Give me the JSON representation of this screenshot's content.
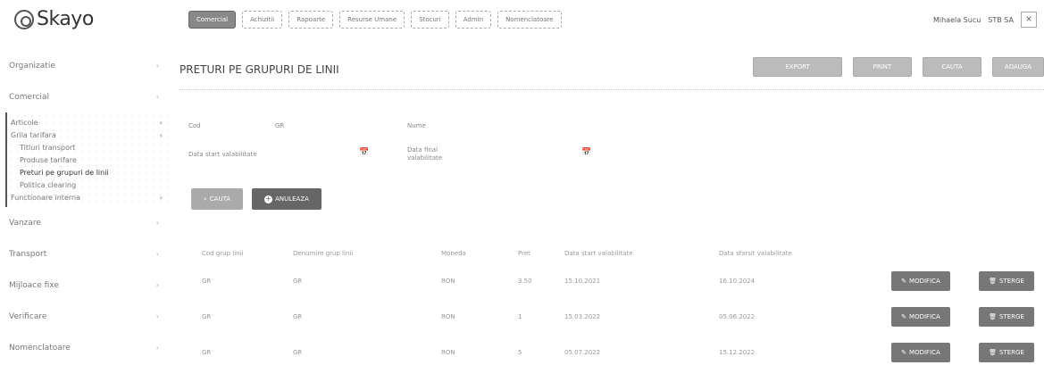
{
  "app": {
    "name": "Skayo"
  },
  "topnav": {
    "tabs": [
      {
        "label": "Comercial",
        "active": true
      },
      {
        "label": "Achizitii"
      },
      {
        "label": "Rapoarte"
      },
      {
        "label": "Resurse Umane"
      },
      {
        "label": "Stocuri"
      },
      {
        "label": "Admin"
      },
      {
        "label": "Nomenclatoare"
      }
    ]
  },
  "user": {
    "name": "Mihaela Sucu",
    "company": "STB SA",
    "close_icon": "×"
  },
  "sidebar": {
    "items_top": [
      {
        "label": "Organizatie",
        "chevron": "›"
      },
      {
        "label": "Comercial",
        "chevron": "‹"
      }
    ],
    "section": {
      "lines": [
        {
          "label": "Articole",
          "chevron": "›",
          "level": 0
        },
        {
          "label": "Grila tarifara",
          "chevron": "‹",
          "level": 0
        },
        {
          "label": "Titluri transport",
          "level": 1
        },
        {
          "label": "Produse tarifare",
          "level": 1
        },
        {
          "label": "Preturi pe grupuri de linii",
          "level": 1,
          "current": true
        },
        {
          "label": "Politica clearing",
          "level": 1
        },
        {
          "label": "Functionare interna",
          "chevron": "›",
          "level": 0
        }
      ]
    },
    "items_bottom": [
      {
        "label": "Vanzare",
        "chevron": "›"
      },
      {
        "label": "Transport",
        "chevron": "›"
      },
      {
        "label": "Mijloace fixe",
        "chevron": "›"
      },
      {
        "label": "Verificare",
        "chevron": "›"
      },
      {
        "label": "Nomenclatoare",
        "chevron": "›"
      }
    ]
  },
  "page": {
    "title": "PRETURI PE GRUPURI DE LINII"
  },
  "actions": {
    "export_label": "EXPORT",
    "print_label": "PRINT",
    "search_label": "CAUTA",
    "add_label": "ADAUGA"
  },
  "form": {
    "code_label": "Cod",
    "code_value": "GR",
    "name_label": "Nume",
    "start_label": "Data start valabilitate",
    "end_label": "Data final valabilitate",
    "search_button": "CAUTA",
    "cancel_button": "ANULEAZA",
    "calendar_icon": "📅"
  },
  "table": {
    "headers": [
      "Cod grup linii",
      "Denumire grup linii",
      "Moneda",
      "Pret",
      "Data start valabilitate",
      "Data sfarsit valabilitate"
    ],
    "rows": [
      {
        "cod": "GR",
        "den": "GR",
        "moneda": "RON",
        "pret": "3.50",
        "start": "15.10.2021",
        "end": "16.10.2024"
      },
      {
        "cod": "GR",
        "den": "GR",
        "moneda": "RON",
        "pret": "1",
        "start": "15.03.2022",
        "end": "05.06.2022"
      },
      {
        "cod": "GR",
        "den": "GR",
        "moneda": "RON",
        "pret": "5",
        "start": "05.07.2022",
        "end": "15.12.2022"
      }
    ],
    "edit_label": "MODIFICA",
    "delete_label": "STERGE",
    "edit_icon": "✎",
    "delete_icon": "🗑"
  },
  "colors": {
    "primary_button": "#777777",
    "active_tab": "#888888"
  }
}
